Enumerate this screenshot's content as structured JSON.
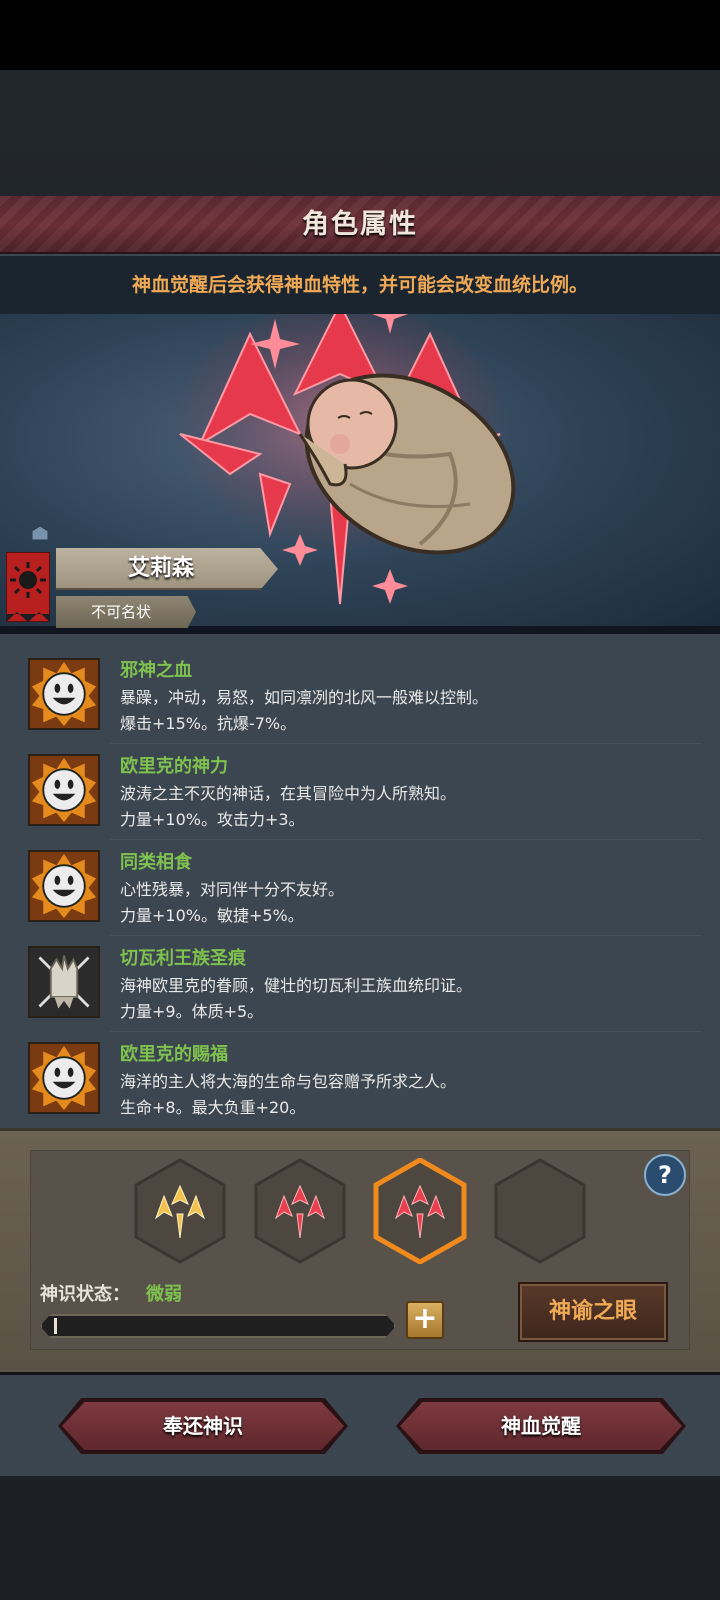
{
  "header": {
    "title": "角色属性",
    "hint": "神血觉醒后会获得神血特性，并可能会改变血统比例。"
  },
  "character": {
    "name": "艾莉森",
    "subtitle": "不可名状",
    "portrait_icon": "swaddled-baby-portrait",
    "emblem_icon": "crimson-divine-sigil",
    "flag_icon": "red-sun-banner-icon"
  },
  "traits": [
    {
      "title": "邪神之血",
      "desc": "暴躁，冲动，易怒，如同凛冽的北风一般难以控制。",
      "stats": "爆击+15%。抗爆-7%。",
      "icon": "smiling-sun-face-icon"
    },
    {
      "title": "欧里克的神力",
      "desc": "波涛之主不灭的神话，在其冒险中为人所熟知。",
      "stats": "力量+10%。攻击力+3。",
      "icon": "smiling-sun-face-icon"
    },
    {
      "title": "同类相食",
      "desc": "心性残暴，对同伴十分不友好。",
      "stats": "力量+10%。敏捷+5%。",
      "icon": "smiling-sun-face-icon"
    },
    {
      "title": "切瓦利王族圣痕",
      "desc": "海神欧里克的眷顾，健壮的切瓦利王族血统印证。",
      "stats": "力量+9。体质+5。",
      "icon": "tattered-crown-icon"
    },
    {
      "title": "欧里克的赐福",
      "desc": "海洋的主人将大海的生命与包容赠予所求之人。",
      "stats": "生命+8。最大负重+20。",
      "icon": "smiling-sun-face-icon"
    }
  ],
  "slots": [
    {
      "state": "gold",
      "icon": "gold-sigil-icon"
    },
    {
      "state": "red",
      "icon": "red-sigil-icon"
    },
    {
      "state": "red-selected",
      "icon": "red-sigil-icon"
    },
    {
      "state": "empty",
      "icon": "empty-slot-icon"
    }
  ],
  "divine_sense": {
    "label": "神识状态：",
    "value": "微弱",
    "progress": 0.01
  },
  "buttons": {
    "plus": "+",
    "help": "?",
    "oracle_eye": "神谕之眼",
    "return_sense": "奉还神识",
    "blood_awaken": "神血觉醒"
  },
  "colors": {
    "accent_orange": "#f0a955",
    "trait_green": "#7fc14e",
    "title_maroon": "#6d3038",
    "sigil_red": "#e83a4a",
    "sigil_gold": "#f2c14e"
  }
}
